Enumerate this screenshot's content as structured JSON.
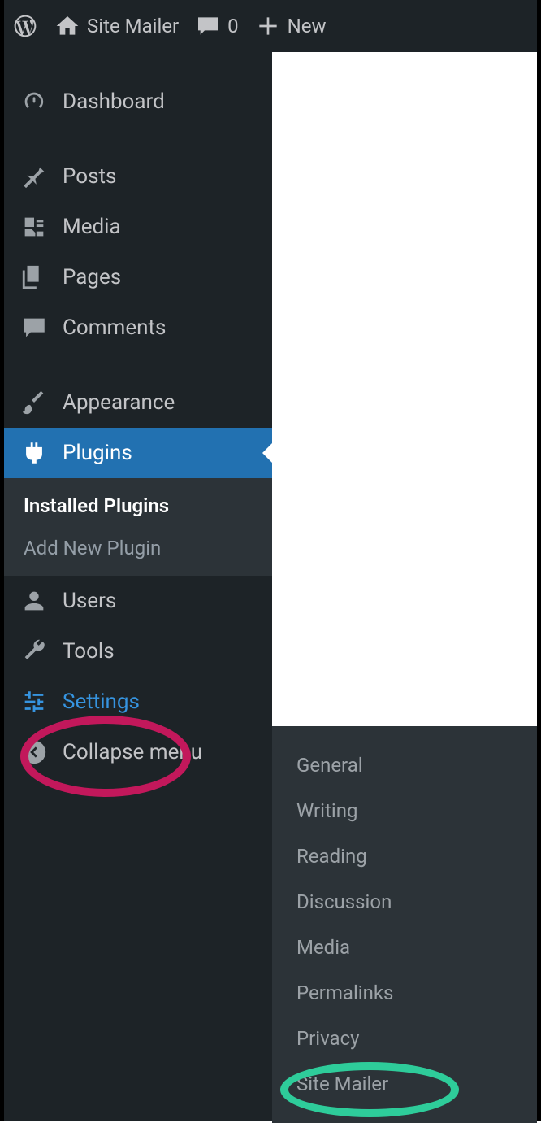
{
  "toolbar": {
    "site_name": "Site Mailer",
    "comments_count": "0",
    "new_label": "New"
  },
  "sidebar": {
    "dashboard": "Dashboard",
    "posts": "Posts",
    "media": "Media",
    "pages": "Pages",
    "comments": "Comments",
    "appearance": "Appearance",
    "plugins": "Plugins",
    "plugins_sub": {
      "installed": "Installed Plugins",
      "add_new": "Add New Plugin"
    },
    "users": "Users",
    "tools": "Tools",
    "settings": "Settings",
    "collapse": "Collapse menu"
  },
  "settings_flyout": {
    "general": "General",
    "writing": "Writing",
    "reading": "Reading",
    "discussion": "Discussion",
    "media": "Media",
    "permalinks": "Permalinks",
    "privacy": "Privacy",
    "site_mailer": "Site Mailer"
  }
}
